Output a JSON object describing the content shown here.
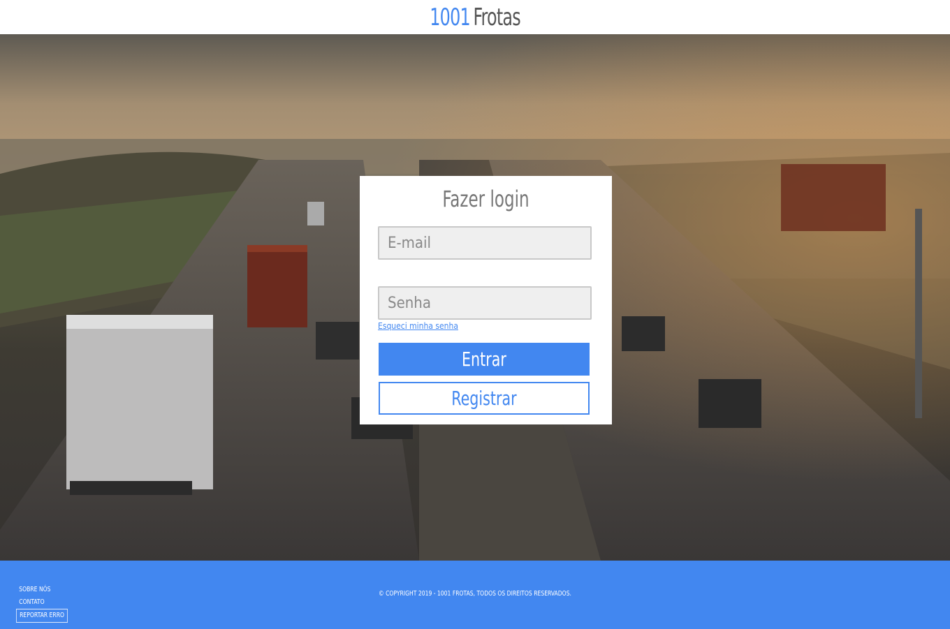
{
  "header": {
    "brand_number": "1001",
    "brand_word": "Frotas"
  },
  "login": {
    "title": "Fazer login",
    "email_placeholder": "E-mail",
    "password_placeholder": "Senha",
    "forgot_link": "Esqueci minha senha",
    "submit_label": "Entrar",
    "register_label": "Registrar"
  },
  "footer": {
    "links": [
      "SOBRE NÓS",
      "CONTATO",
      "REPORTAR ERRO"
    ],
    "copyright": "© COPYRIGHT 2019 - 1001 FROTAS, TODOS OS DIREITOS RESERVADOS."
  },
  "colors": {
    "accent": "#4287f0",
    "footer_bg": "#4287f0"
  }
}
